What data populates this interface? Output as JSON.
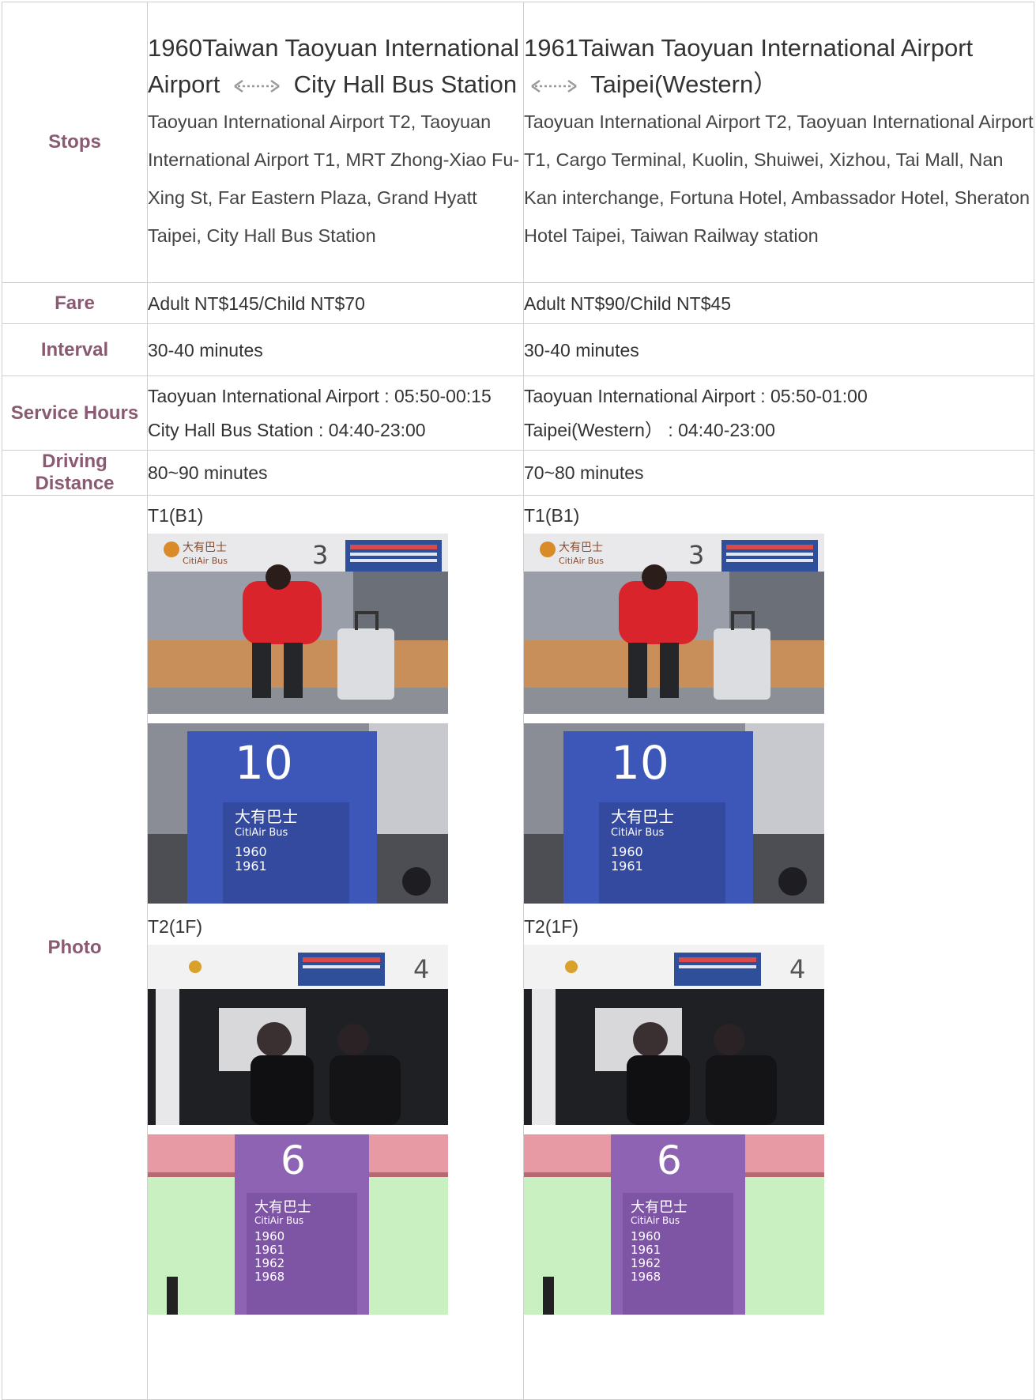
{
  "rows": {
    "stops": {
      "label": "Stops",
      "col1": {
        "route_num": "1960",
        "route_from": "Taiwan Taoyuan International Airport",
        "route_to": "City Hall Bus Station",
        "stops": "Taoyuan International Airport T2, Taoyuan International Airport T1, MRT Zhong-Xiao Fu-Xing St, Far Eastern Plaza, Grand Hyatt Taipei, City Hall Bus Station"
      },
      "col2": {
        "route_num": "1961",
        "route_from": "Taiwan Taoyuan International Airport",
        "route_to": "Taipei(Western）",
        "stops": "Taoyuan International Airport T2, Taoyuan International Airport T1, Cargo Terminal, Kuolin, Shuiwei, Xizhou, Tai Mall, Nan Kan interchange, Fortuna Hotel, Ambassador Hotel,   Sheraton Hotel Taipei, Taiwan Railway station"
      }
    },
    "fare": {
      "label": "Fare",
      "col1": "Adult NT$145/Child NT$70",
      "col2": "Adult NT$90/Child NT$45"
    },
    "interval": {
      "label": "Interval",
      "col1": "30-40 minutes",
      "col2": "30-40 minutes"
    },
    "service_hours": {
      "label": "Service Hours",
      "col1_line1": "Taoyuan International Airport : 05:50-00:15",
      "col1_line2": "City Hall Bus Station : 04:40-23:00",
      "col2_line1": "Taoyuan International Airport : 05:50-01:00",
      "col2_line2": "Taipei(Western）  : 04:40-23:00"
    },
    "driving_distance": {
      "label": "Driving Distance",
      "col1": "80~90 minutes",
      "col2": "70~80 minutes"
    },
    "photo": {
      "label": "Photo",
      "t1_label": "T1(B1)",
      "t2_label": "T2(1F)",
      "counter3_logo": "大有巴士",
      "counter3_logo_en": "CitiAir Bus",
      "counter3_num": "3",
      "gate10_num": "10",
      "gate10_cn": "大有巴士",
      "gate10_en": "CitiAir Bus",
      "gate10_r1": "1960",
      "gate10_r2": "1961",
      "counter4_num": "4",
      "gate6_num": "6",
      "gate6_cn": "大有巴士",
      "gate6_en": "CitiAir Bus",
      "gate6_r1": "1960",
      "gate6_r2": "1961",
      "gate6_r3": "1962",
      "gate6_r4": "1968"
    }
  },
  "colors": {
    "header_text": "#8a5a72",
    "border": "#cfcfcf"
  }
}
